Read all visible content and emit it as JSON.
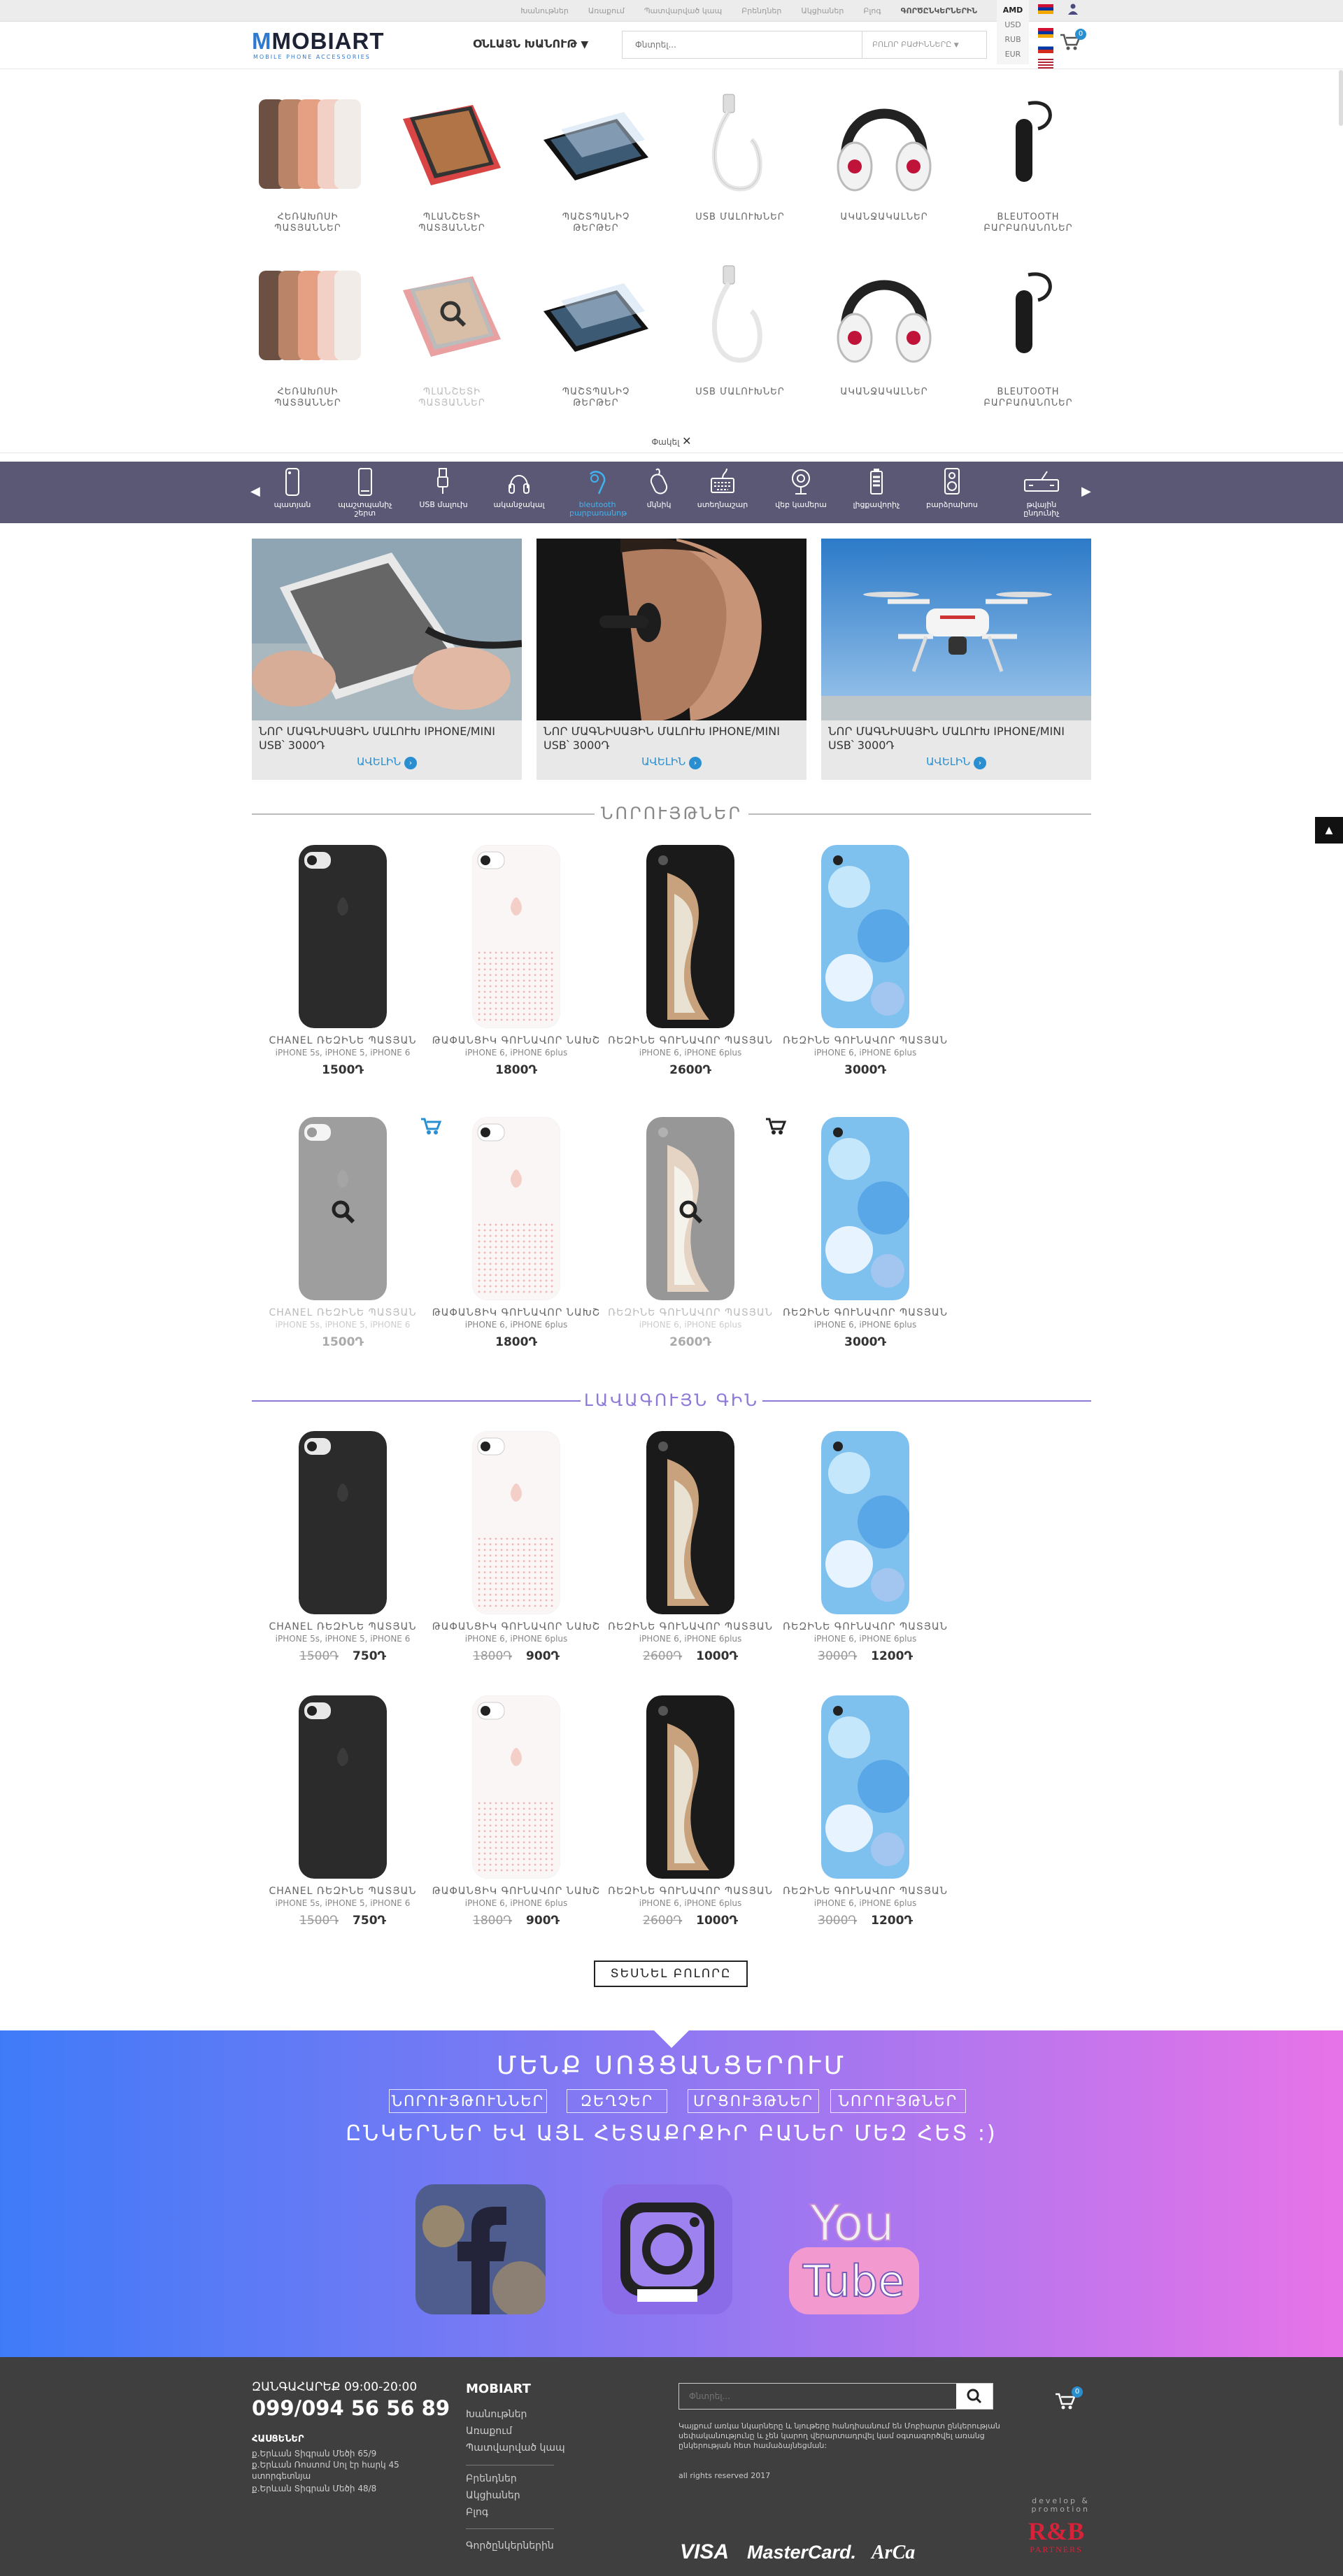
{
  "topbar": {
    "nav": [
      "Խանութներ",
      "Առաքում",
      "Պատվարված կապ",
      "Բրենդներ",
      "Ակցիաներ",
      "Բլոգ",
      "ԳՈՐԾԸՆԿԵՐՆԵՐԻՆ"
    ],
    "currencies": [
      "AMD",
      "USD",
      "RUB",
      "EUR"
    ]
  },
  "header": {
    "logo_text": "MOBIART",
    "logo_sub": "MOBILE PHONE ACCESSORIES",
    "online_store": "ՕՆԼԱՅՆ ԽԱՆՈՒԹ",
    "search_placeholder": "Փնտրել...",
    "search_category": "ԲՈԼՈՐ ԲԱԺԻՆՆԵՐԸ",
    "cart_count": "0"
  },
  "categories": {
    "row1": [
      "ՀԵՌԱԽՈՍԻ ՊԱՏՅԱՆՆԵՐ",
      "ՊԼԱՆՇԵՏԻ ՊԱՏՅԱՆՆԵՐ",
      "ՊԱՇՏՊԱՆԻՉ ԹԵՐԹԵՐ",
      "USB ՄԱԼՈՒԽՆԵՐ",
      "ԱԿԱՆՋԱԿԱԼՆԵՐ",
      "BLEUTOOTH ԲԱՐԲԱՌԱՆՈՆԵՐ"
    ],
    "row2": [
      "ՀԵՌԱԽՈՍԻ ՊԱՏՅԱՆՆԵՐ",
      "ՊԼԱՆՇԵՏԻ ՊԱՏՅԱՆՆԵՐ",
      "ՊԱՇՏՊԱՆԻՉ ԹԵՐԹԵՐ",
      "USB ՄԱԼՈՒԽՆԵՐ",
      "ԱԿԱՆՋԱԿԱԼՆԵՐ",
      "BLEUTOOTH ԲԱՐԲԱՌԱՆՈՆԵՐ"
    ],
    "close_label": "Փակել"
  },
  "iconnav": [
    "պատյան",
    "պաշտպանիչ շերտ",
    "USB մալուխ",
    "ականջակալ",
    "bleutooth բարբառանոթ",
    "մկնիկ",
    "ստեղնաշար",
    "վեբ կամերա",
    "լիցքավորիչ",
    "բարձրախոս",
    "թվային ընդունիչ"
  ],
  "banners": [
    {
      "title": "ՆՈՐ ՄԱԳՆԻՍԱՅԻՆ ՄԱԼՈՒԽ IPHONE/MINI USB՝ 3000Դ",
      "more": "ԱՎԵԼԻՆ"
    },
    {
      "title": "ՆՈՐ ՄԱԳՆԻՍԱՅԻՆ ՄԱԼՈՒԽ IPHONE/MINI USB՝ 3000Դ",
      "more": "ԱՎԵԼԻՆ"
    },
    {
      "title": "ՆՈՐ ՄԱԳՆԻՍԱՅԻՆ ՄԱԼՈՒԽ IPHONE/MINI USB՝ 3000Դ",
      "more": "ԱՎԵԼԻՆ"
    }
  ],
  "sections": {
    "new": "ՆՈՐՈՒՅԹՆԵՐ",
    "best": "ԼԱՎԱԳՈՒՅՆ ԳԻՆ"
  },
  "new_products": [
    {
      "name": "CHANEL ՌԵԶԻՆԵ ՊԱՏՅԱՆ",
      "sub": "iPHONE 5s, iPHONE 5, iPHONE 6",
      "price": "1500Դ"
    },
    {
      "name": "ԹԱՓԱՆՑԻԿ ԳՈՒՆԱՎՈՐ ՆԱԽՇ",
      "sub": "iPHONE 6, iPHONE 6plus",
      "price": "1800Դ"
    },
    {
      "name": "ՌԵԶԻՆԵ ԳՈՒՆԱՎՈՐ ՊԱՏՅԱՆ",
      "sub": "iPHONE 6, iPHONE 6plus",
      "price": "2600Դ"
    },
    {
      "name": "ՌԵԶԻՆԵ ԳՈՒՆԱՎՈՐ ՊԱՏՅԱՆ",
      "sub": "iPHONE 6, iPHONE 6plus",
      "price": "3000Դ"
    },
    {
      "name": "CHANEL ՌԵԶԻՆԵ ՊԱՏՅԱՆ",
      "sub": "iPHONE 5s, iPHONE 5, iPHONE 6",
      "price": "1500Դ"
    },
    {
      "name": "ԹԱՓԱՆՑԻԿ ԳՈՒՆԱՎՈՐ ՆԱԽՇ",
      "sub": "iPHONE 6, iPHONE 6plus",
      "price": "1800Դ"
    },
    {
      "name": "ՌԵԶԻՆԵ ԳՈՒՆԱՎՈՐ ՊԱՏՅԱՆ",
      "sub": "iPHONE 6, iPHONE 6plus",
      "price": "2600Դ"
    },
    {
      "name": "ՌԵԶԻՆԵ ԳՈՒՆԱՎՈՐ ՊԱՏՅԱՆ",
      "sub": "iPHONE 6, iPHONE 6plus",
      "price": "3000Դ"
    }
  ],
  "best_products": [
    {
      "name": "CHANEL ՌԵԶԻՆԵ ՊԱՏՅԱՆ",
      "sub": "iPHONE 5s, iPHONE 5, iPHONE 6",
      "old": "1500Դ",
      "price": "750Դ"
    },
    {
      "name": "ԹԱՓԱՆՑԻԿ ԳՈՒՆԱՎՈՐ ՆԱԽՇ",
      "sub": "iPHONE 6, iPHONE 6plus",
      "old": "1800Դ",
      "price": "900Դ"
    },
    {
      "name": "ՌԵԶԻՆԵ ԳՈՒՆԱՎՈՐ ՊԱՏՅԱՆ",
      "sub": "iPHONE 6, iPHONE 6plus",
      "old": "2600Դ",
      "price": "1000Դ"
    },
    {
      "name": "ՌԵԶԻՆԵ ԳՈՒՆԱՎՈՐ ՊԱՏՅԱՆ",
      "sub": "iPHONE 6, iPHONE 6plus",
      "old": "3000Դ",
      "price": "1200Դ"
    },
    {
      "name": "CHANEL ՌԵԶԻՆԵ ՊԱՏՅԱՆ",
      "sub": "iPHONE 5s, iPHONE 5, iPHONE 6",
      "old": "1500Դ",
      "price": "750Դ"
    },
    {
      "name": "ԹԱՓԱՆՑԻԿ ԳՈՒՆԱՎՈՐ ՆԱԽՇ",
      "sub": "iPHONE 6, iPHONE 6plus",
      "old": "1800Դ",
      "price": "900Դ"
    },
    {
      "name": "ՌԵԶԻՆԵ ԳՈՒՆԱՎՈՐ ՊԱՏՅԱՆ",
      "sub": "iPHONE 6, iPHONE 6plus",
      "old": "2600Դ",
      "price": "1000Դ"
    },
    {
      "name": "ՌԵԶԻՆԵ ԳՈՒՆԱՎՈՐ ՊԱՏՅԱՆ",
      "sub": "iPHONE 6, iPHONE 6plus",
      "old": "3000Դ",
      "price": "1200Դ"
    }
  ],
  "show_all": "ՏԵՍՆԵԼ ԲՈԼՈՐԸ",
  "social": {
    "title": "ՄԵՆՔ ՍՈՑՑԱՆՑԵՐՈՒՄ",
    "tags": [
      "ՆՈՐՈՒՅԹՈՒՆՆԵՐ",
      "ԶԵՂՉԵՐ",
      "ՄՐՑՈՒՅԹՆԵՐ",
      "ՆՈՐՈՒՅԹՆԵՐ"
    ],
    "subtitle": "ԸՆԿԵՐՆԵՐ ԵՎ ԱՅԼ ՀԵՏԱՔՐՔԻՐ ԲԱՆԵՐ ՄԵԶ ՀԵՏ :)"
  },
  "footer": {
    "hours_label": "ԶԱՆԳԱՀԱՐԵՔ 09:00-20:00",
    "phone": "099/094 56 56 89",
    "addresses_label": "ՀԱՍՑԵՆԵՐ",
    "addresses": [
      "ք.Երևան Տիգրան Մեծի 65/9",
      "ք.Երևան Ռոստոմ Սոլ էր հարկ 45 ստորգետնյա",
      "ք.Երևան Տիգրան Մեծի 48/8"
    ],
    "brand": "MOBIART",
    "links1": [
      "Խանութներ",
      "Առաքում",
      "Պատվարված կապ"
    ],
    "links2": [
      "Բրենդներ",
      "Ակցիաներ",
      "Բլոգ"
    ],
    "links3": [
      "Գործընկերներին"
    ],
    "search_placeholder": "Փնտրել...",
    "note": "Կայքում առկա նկարները և նյութերը հանդիսանում են Մոբիարտ ընկերության սեփականությունը և չեն կարող վերարտադրվել կամ օգտագործվել առանց ընկերության հետ համաձայնեցման:",
    "rights": "all rights reserved 2017",
    "cards": [
      "VISA",
      "MasterCard.",
      "ArCa"
    ],
    "dev": "develop & promotion",
    "partner": "R&B",
    "partner_sub": "PARTNERS",
    "cart_count": "0"
  }
}
